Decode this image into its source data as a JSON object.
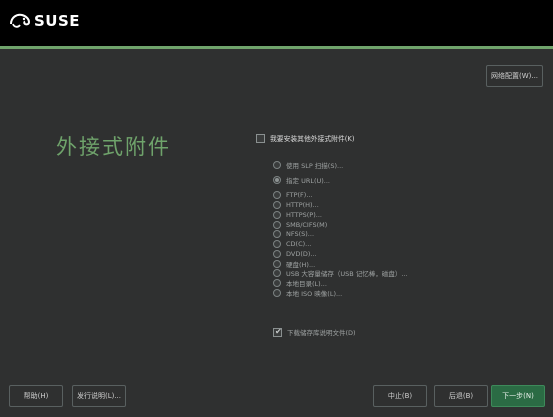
{
  "brand": {
    "name": "SUSE",
    "accent": "#6fa36b",
    "primary_button": "#2b6b44"
  },
  "header": {
    "network_config_label": "网络配置(W)..."
  },
  "page": {
    "title": "外接式附件"
  },
  "main_checkbox": {
    "label": "我要安装其他外接式附件(K)",
    "checked": false
  },
  "options": [
    {
      "label": "使用 SLP 扫描(S)...",
      "selected": false
    },
    {
      "label": "指定 URL(U)...",
      "selected": true
    },
    {
      "label": "FTP(F)...",
      "selected": false
    },
    {
      "label": "HTTP(H)...",
      "selected": false
    },
    {
      "label": "HTTPS(P)...",
      "selected": false
    },
    {
      "label": "SMB/CIFS(M)",
      "selected": false
    },
    {
      "label": "NFS(S)...",
      "selected": false
    },
    {
      "label": "CD(C)...",
      "selected": false
    },
    {
      "label": "DVD(D)...",
      "selected": false
    },
    {
      "label": "硬盘(H)...",
      "selected": false
    },
    {
      "label": "USB 大容量储存（USB 记忆棒，磁盘）...",
      "selected": false
    },
    {
      "label": "本地目录(L)...",
      "selected": false
    },
    {
      "label": "本地 ISO 映像(L)...",
      "selected": false
    }
  ],
  "readme_checkbox": {
    "label": "下载储存库说明文件(D)",
    "checked": true
  },
  "footer": {
    "help": "帮助(H)",
    "release_notes": "发行说明(L)...",
    "abort": "中止(B)",
    "back": "后退(B)",
    "next": "下一步(N)"
  }
}
